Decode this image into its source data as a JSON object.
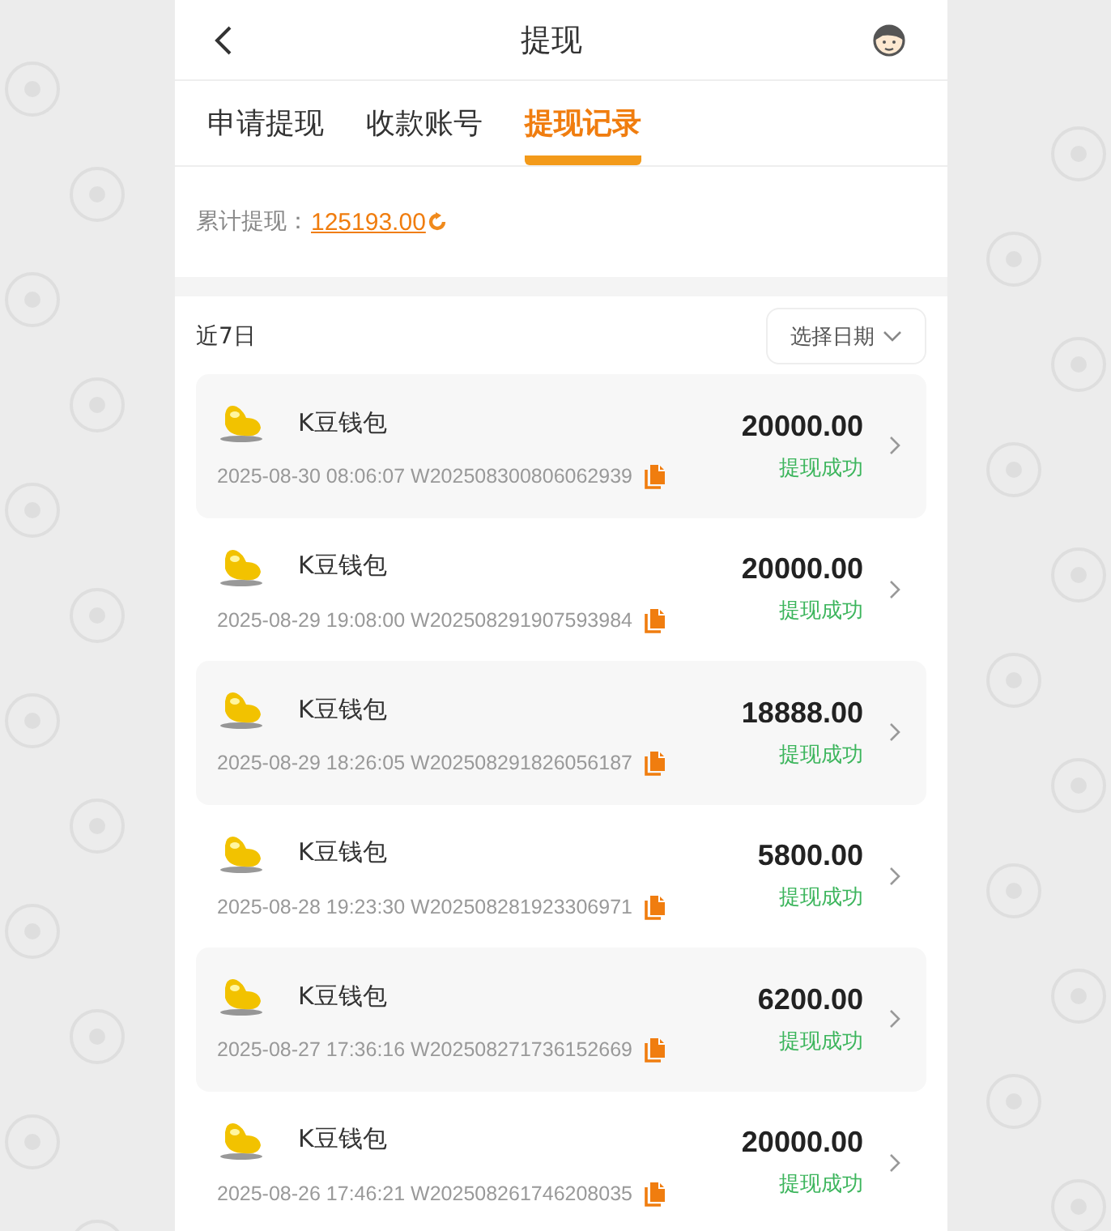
{
  "header": {
    "title": "提现"
  },
  "tabs": [
    {
      "label": "申请提现",
      "selected": false
    },
    {
      "label": "收款账号",
      "selected": false
    },
    {
      "label": "提现记录",
      "selected": true
    }
  ],
  "total": {
    "label": "累计提现：",
    "amount": "125193.00"
  },
  "filter": {
    "period": "近7日",
    "date_button": "选择日期"
  },
  "records": [
    {
      "wallet": "K豆钱包",
      "time": "2025-08-30 08:06:07",
      "order": "W202508300806062939",
      "amount": "20000.00",
      "status": "提现成功"
    },
    {
      "wallet": "K豆钱包",
      "time": "2025-08-29 19:08:00",
      "order": "W202508291907593984",
      "amount": "20000.00",
      "status": "提现成功"
    },
    {
      "wallet": "K豆钱包",
      "time": "2025-08-29 18:26:05",
      "order": "W202508291826056187",
      "amount": "18888.00",
      "status": "提现成功"
    },
    {
      "wallet": "K豆钱包",
      "time": "2025-08-28 19:23:30",
      "order": "W202508281923306971",
      "amount": "5800.00",
      "status": "提现成功"
    },
    {
      "wallet": "K豆钱包",
      "time": "2025-08-27 17:36:16",
      "order": "W202508271736152669",
      "amount": "6200.00",
      "status": "提现成功"
    },
    {
      "wallet": "K豆钱包",
      "time": "2025-08-26 17:46:21",
      "order": "W202508261746208035",
      "amount": "20000.00",
      "status": "提现成功"
    }
  ]
}
